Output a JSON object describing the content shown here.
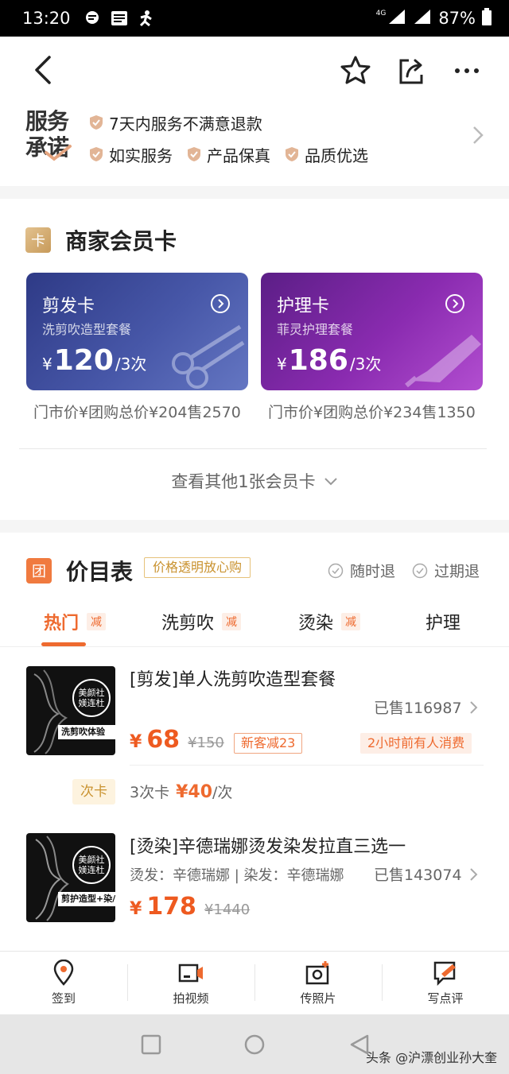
{
  "status_bar": {
    "time": "13:20",
    "network": "4G",
    "battery": "87%"
  },
  "service_promise": {
    "logo_line1": "服务",
    "logo_line2": "承诺",
    "row1": [
      "7天内服务不满意退款"
    ],
    "row2": [
      "如实服务",
      "产品保真",
      "品质优选"
    ]
  },
  "members": {
    "badge": "卡",
    "title": "商家会员卡",
    "cards": [
      {
        "name": "剪发卡",
        "subtitle": "洗剪吹造型套餐",
        "yen": "¥",
        "price": "120",
        "unit": "/3次",
        "meta": "门市价¥团购总价¥204售2570",
        "accent": "#3b4a9a"
      },
      {
        "name": "护理卡",
        "subtitle": "菲灵护理套餐",
        "yen": "¥",
        "price": "186",
        "unit": "/3次",
        "meta": "门市价¥团购总价¥234售1350",
        "accent": "#7a22a6"
      }
    ],
    "view_more": "查看其他1张会员卡"
  },
  "price_list": {
    "badge": "团",
    "title": "价目表",
    "transparent_tag": "价格透明放心购",
    "refund_anytime": "随时退",
    "refund_expired": "过期退",
    "tabs": [
      {
        "label": "热门",
        "tag": "减"
      },
      {
        "label": "洗剪吹",
        "tag": "减"
      },
      {
        "label": "烫染",
        "tag": "减"
      },
      {
        "label": "护理",
        "tag": ""
      }
    ],
    "deals": [
      {
        "title": "[剪发]单人洗剪吹造型套餐",
        "sold": "已售116987",
        "yen": "¥",
        "price": "68",
        "original": "¥150",
        "newbie": "新客减23",
        "recent": "2小时前有人消费",
        "thumb_brand": "美颜社 媄连杜",
        "thumb_band": "洗剪吹体验"
      },
      {
        "title": "[烫染]辛德瑞娜烫发染发拉直三选一",
        "detail": "烫发：辛德瑞娜 | 染发：辛德瑞娜",
        "sold": "已售143074",
        "yen": "¥",
        "price": "178",
        "original": "¥1440",
        "thumb_brand": "美颜社 媄连杜",
        "thumb_band": "剪护造型+染/烫"
      }
    ],
    "times_card": {
      "tag": "次卡",
      "prefix": "3次卡",
      "price": "¥40",
      "suffix": "/次"
    }
  },
  "action_bar": [
    {
      "label": "签到",
      "icon": "location-pin-icon"
    },
    {
      "label": "拍视频",
      "icon": "video-camera-icon"
    },
    {
      "label": "传照片",
      "icon": "photo-upload-icon"
    },
    {
      "label": "写点评",
      "icon": "write-review-icon"
    }
  ],
  "watermark": "头条 @沪漂创业孙大奎",
  "colors": {
    "accent": "#ee6a2f",
    "gold": "#c9922f"
  }
}
